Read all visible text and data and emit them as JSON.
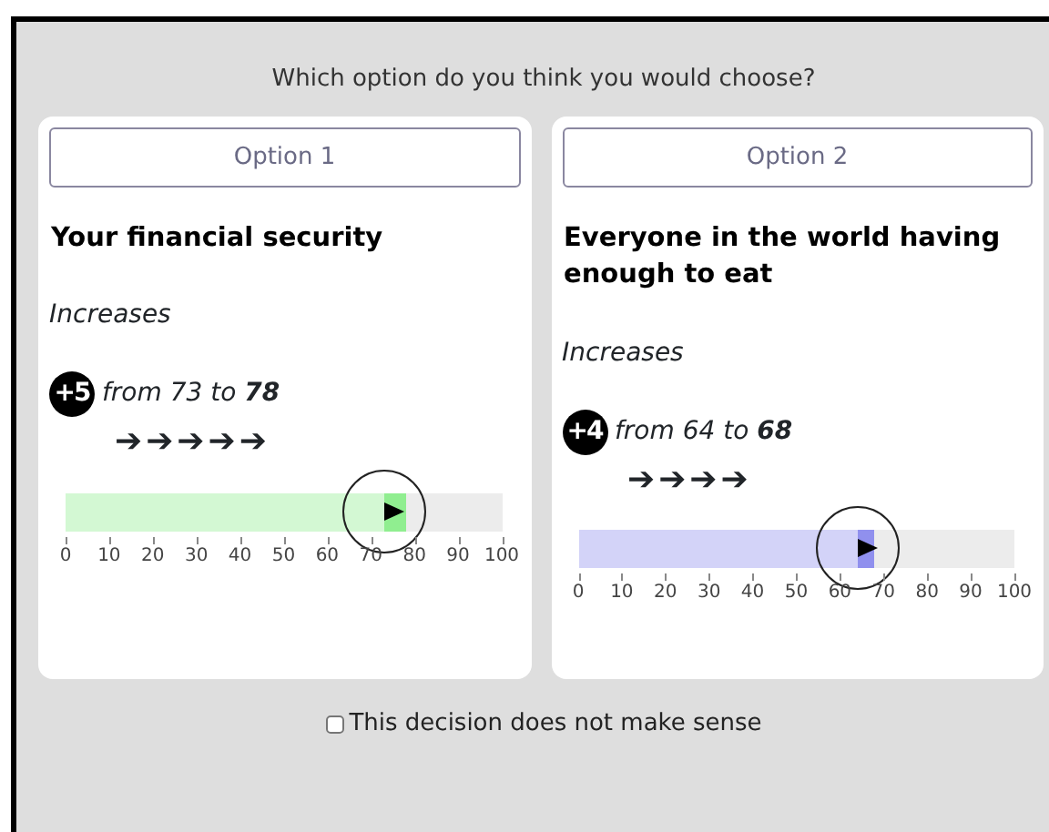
{
  "question": "Which option do you think you would choose?",
  "options": [
    {
      "button": "Option 1",
      "title": "Your financial security",
      "direction": "Increases",
      "change": "+5",
      "change_text": "from 73 to **78**",
      "arrows": "➔➔➔➔➔",
      "start": {
        "level": 0.73
      },
      "end": {
        "level": 0.78
      },
      "color": "#90ee90",
      "scale": [
        "0",
        "10",
        "20",
        "30",
        "40",
        "50",
        "60",
        "70",
        "80",
        "90",
        "100"
      ]
    },
    {
      "button": "Option 2",
      "title": "Everyone in the world having enough to eat",
      "direction": "Increases",
      "change": "+4",
      "change_text": "from 64 to **68**",
      "arrows": "➔➔➔➔",
      "start": {
        "level": 0.64
      },
      "end": {
        "level": 0.68
      },
      "color": "#9090ee",
      "scale": [
        "0",
        "10",
        "20",
        "30",
        "40",
        "50",
        "60",
        "70",
        "80",
        "90",
        "100"
      ]
    }
  ],
  "nonsense": {
    "label": "This decision does not make sense",
    "checked": false
  }
}
